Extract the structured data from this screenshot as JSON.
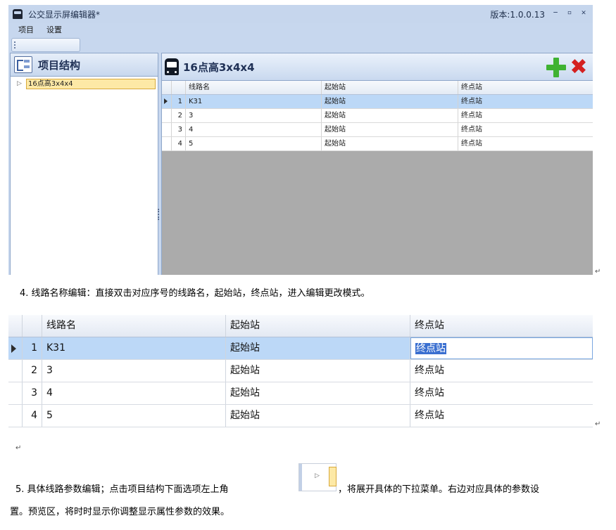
{
  "app": {
    "title": "公交显示屏编辑器*",
    "version": "版本:1.0.0.13",
    "window_buttons": [
      "−",
      "▫",
      "✕"
    ],
    "menu": [
      "项目",
      "设置"
    ]
  },
  "left_panel": {
    "title": "项目结构",
    "tree_arrow": "▷",
    "tree_node": "16点高3x4x4"
  },
  "right_panel": {
    "title": "16点高3x4x4",
    "delete_symbol": "✖"
  },
  "table": {
    "headers": [
      "线路名",
      "起始站",
      "终点站"
    ],
    "rows": [
      {
        "num": "1",
        "line": "K31",
        "start": "起始站",
        "end": "终点站"
      },
      {
        "num": "2",
        "line": "3",
        "start": "起始站",
        "end": "终点站"
      },
      {
        "num": "3",
        "line": "4",
        "start": "起始站",
        "end": "终点站"
      },
      {
        "num": "4",
        "line": "5",
        "start": "起始站",
        "end": "终点站"
      }
    ]
  },
  "doc": {
    "para4": "4. 线路名称编辑：直接双击对应序号的线路名，起始站，终点站，进入编辑更改模式。",
    "para5_a": "5. 具体线路参数编辑；点击项目结构下面选项左上角",
    "para5_b": "，将展开具体的下拉菜单。右边对应具体的参数设",
    "para5_c": "置。预览区，将时时显示你调整显示属性参数的效果。",
    "return_mark": "↵",
    "snippet_arrow": "▷"
  }
}
